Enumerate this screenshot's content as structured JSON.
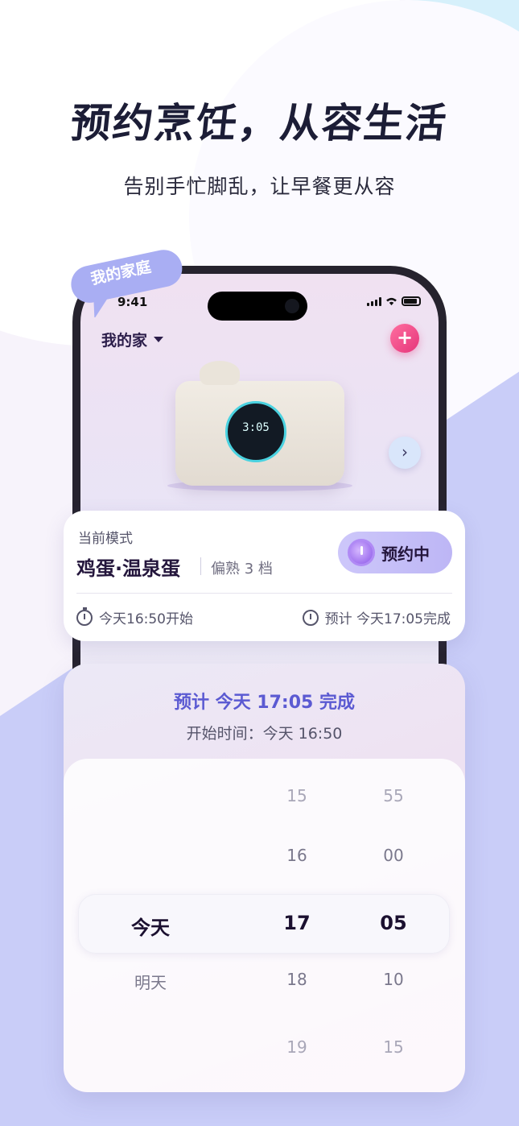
{
  "headline": "预约烹饪，从容生活",
  "subline": "告别手忙脚乱，让早餐更从容",
  "bubble": {
    "label": "我的家庭"
  },
  "phone": {
    "status_time": "9:41",
    "home_name": "我的家",
    "device_display": "3:05"
  },
  "mode_card": {
    "label": "当前模式",
    "title": "鸡蛋·温泉蛋",
    "level": "偏熟 3 档",
    "status": "预约中",
    "start": "今天16:50开始",
    "end": "预计 今天17:05完成"
  },
  "picker": {
    "heading": "预计 今天 17:05 完成",
    "start_time": "开始时间：今天 16:50",
    "day_items": [
      "今天",
      "明天"
    ],
    "hour_items": [
      "15",
      "16",
      "17",
      "18",
      "19"
    ],
    "minute_items": [
      "55",
      "00",
      "05",
      "10",
      "15"
    ],
    "selected": {
      "day": "今天",
      "hour": "17",
      "minute": "05"
    }
  },
  "colors": {
    "accent_blue": "#5b5ad2",
    "badge_purple": "#c4befa",
    "add_pink": "#e5357a",
    "bubble": "#a9aef3"
  }
}
